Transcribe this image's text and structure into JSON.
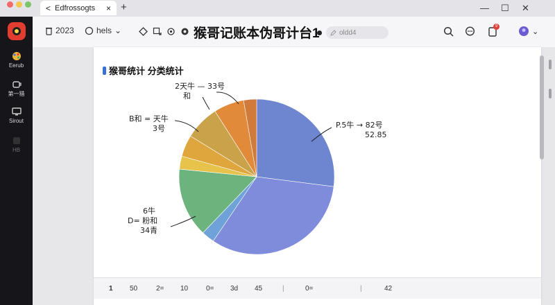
{
  "window": {
    "tab_title": "Edfrossogts",
    "back_glyph": "<",
    "close_glyph": "×",
    "new_tab_glyph": "+",
    "minimize_glyph": "—",
    "maximize_glyph": "☐",
    "window_close_glyph": "✕"
  },
  "rail": {
    "items": [
      {
        "label": "Eerub",
        "icon": "palette-icon"
      },
      {
        "label": "第一猎",
        "icon": "coffee-icon"
      },
      {
        "label": "Sirout",
        "icon": "monitor-icon"
      },
      {
        "label": "HB",
        "icon": "tool-icon"
      }
    ]
  },
  "toolbar": {
    "year": "2023",
    "user": "hels",
    "user_caret": "⌄",
    "title": "猴哥记账本伪哥计台1",
    "pill_text": "oldd4",
    "notification_count": "9",
    "account_caret": "⌄"
  },
  "chart": {
    "title": "猴哥统计 分类统计",
    "annotations": {
      "top": [
        "2天牛 —  33号",
        "和"
      ],
      "upper_left": [
        "B和 = 天牛",
        "3号"
      ],
      "right": [
        "P.5牛 →  82号",
        "52.85"
      ],
      "left": [
        "6牛",
        "D= 粉和",
        "34青"
      ]
    }
  },
  "chart_data": {
    "type": "pie",
    "title": "猴哥统计 分类统计",
    "slices": [
      {
        "value": 30,
        "color": "#6e86d0"
      },
      {
        "value": 36,
        "color": "#7f8cdc"
      },
      {
        "value": 3,
        "color": "#6ea2d8"
      },
      {
        "value": 16,
        "color": "#6db37e"
      },
      {
        "value": 3,
        "color": "#e8c34c"
      },
      {
        "value": 5,
        "color": "#e0a63e"
      },
      {
        "value": 8,
        "color": "#c9a24a"
      },
      {
        "value": 7,
        "color": "#e08a3a"
      },
      {
        "value": 3,
        "color": "#d07a3c"
      }
    ]
  },
  "bottom_bar": [
    "1",
    "50",
    "2=",
    "10",
    "0=",
    "3d",
    "45",
    "|",
    "0=",
    "|",
    "42"
  ]
}
